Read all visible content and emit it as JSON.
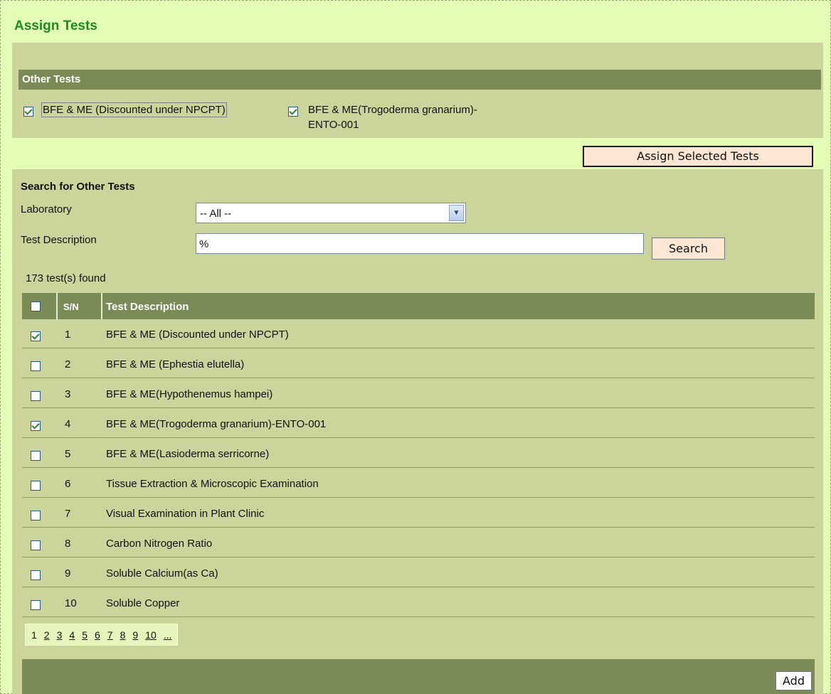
{
  "page_title": "Assign Tests",
  "other_tests": {
    "section_title": "Other Tests",
    "selected": [
      {
        "label": "BFE & ME (Discounted under NPCPT)",
        "checked": true
      },
      {
        "label_line1": "BFE & ME(Trogoderma granarium)-",
        "label_line2": "ENTO-001",
        "checked": true
      }
    ],
    "assign_button": "Assign Selected Tests"
  },
  "search": {
    "section_title": "Search for Other Tests",
    "laboratory_label": "Laboratory",
    "laboratory_value": "-- All --",
    "test_description_label": "Test Description",
    "test_description_value": "%",
    "search_button": "Search",
    "results_count": "173 test(s) found"
  },
  "table": {
    "columns": {
      "sn": "S/N",
      "description": "Test Description"
    },
    "rows": [
      {
        "sn": "1",
        "description": "BFE & ME (Discounted under NPCPT)",
        "checked": true
      },
      {
        "sn": "2",
        "description": "BFE & ME (Ephestia elutella)",
        "checked": false
      },
      {
        "sn": "3",
        "description": "BFE & ME(Hypothenemus hampei)",
        "checked": false
      },
      {
        "sn": "4",
        "description": "BFE & ME(Trogoderma granarium)-ENTO-001",
        "checked": true
      },
      {
        "sn": "5",
        "description": "BFE & ME(Lasioderma serricorne)",
        "checked": false
      },
      {
        "sn": "6",
        "description": "Tissue Extraction & Microscopic Examination",
        "checked": false
      },
      {
        "sn": "7",
        "description": "Visual Examination in Plant Clinic",
        "checked": false
      },
      {
        "sn": "8",
        "description": "Carbon Nitrogen Ratio",
        "checked": false
      },
      {
        "sn": "9",
        "description": "Soluble Calcium(as Ca)",
        "checked": false
      },
      {
        "sn": "10",
        "description": "Soluble Copper",
        "checked": false
      }
    ]
  },
  "pagination": {
    "current": "1",
    "pages": [
      "2",
      "3",
      "4",
      "5",
      "6",
      "7",
      "8",
      "9",
      "10",
      "..."
    ]
  },
  "add_button": "Add",
  "colors": {
    "page_background": "#e3fcb6",
    "panel": "#cbd49a",
    "header_bar": "#7b8b55",
    "title_green": "#1f8a1f",
    "button": "#fde6d3"
  }
}
